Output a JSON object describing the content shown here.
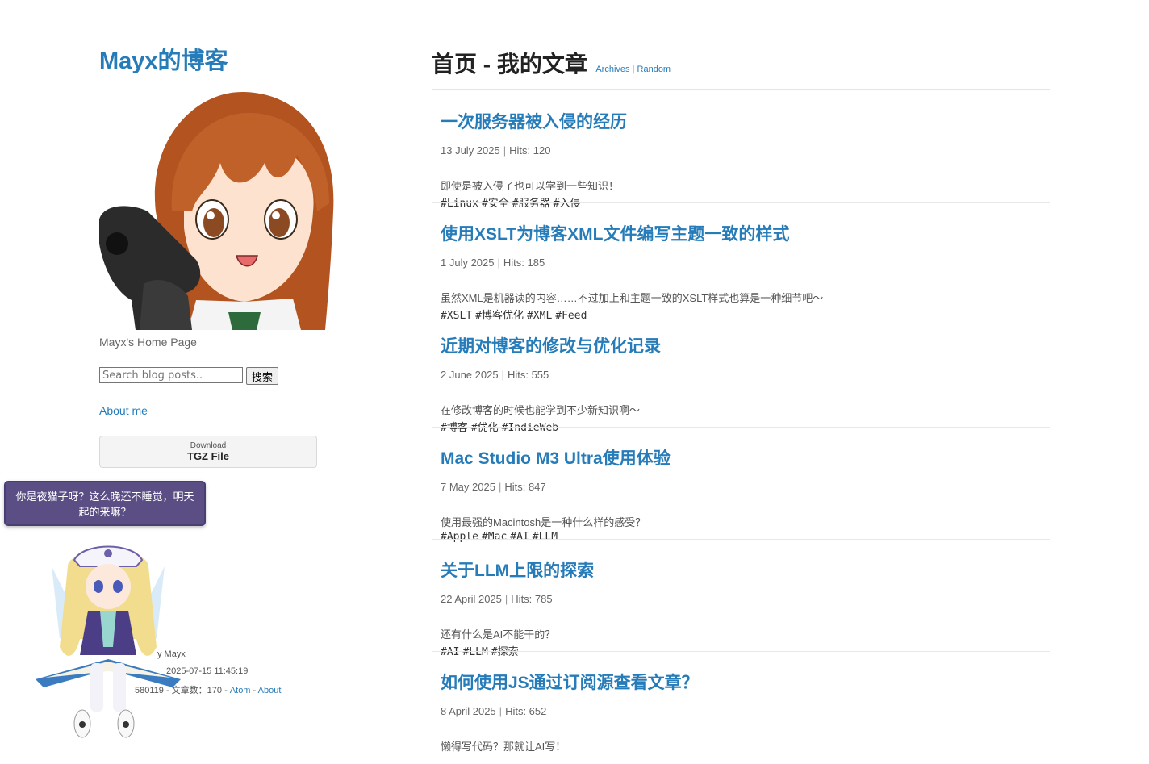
{
  "site": {
    "title": "Mayx的博客",
    "tagline": "Mayx's Home Page",
    "search": {
      "placeholder": "Search blog posts..",
      "button": "搜索"
    },
    "about_link": "About me",
    "download": {
      "small": "Download",
      "big": "TGZ File"
    },
    "footer": {
      "line1": "y Mayx",
      "line2": "2025-07-15 11:45:19",
      "line3_prefix": "580119 - 文章数：170 - ",
      "atom": "Atom",
      "dash": " - ",
      "about": "About"
    }
  },
  "bubble": {
    "text": "你是夜猫子呀？这么晚还不睡觉，明天起的来嘛？"
  },
  "header": {
    "title": "首页 - 我的文章",
    "archives": "Archives",
    "sep": "|",
    "random": "Random"
  },
  "posts": [
    {
      "title": "一次服务器被入侵的经历",
      "date": "13 July 2025",
      "hits": "Hits: 120",
      "excerpt": "即使是被入侵了也可以学到一些知识！",
      "tags": [
        "#Linux",
        "#安全",
        "#服务器",
        "#入侵"
      ]
    },
    {
      "title": "使用XSLT为博客XML文件编写主题一致的样式",
      "date": "1 July 2025",
      "hits": "Hits: 185",
      "excerpt": "虽然XML是机器读的内容……不过加上和主题一致的XSLT样式也算是一种细节吧～",
      "tags": [
        "#XSLT",
        "#博客优化",
        "#XML",
        "#Feed"
      ]
    },
    {
      "title": "近期对博客的修改与优化记录",
      "date": "2 June 2025",
      "hits": "Hits: 555",
      "excerpt": "在修改博客的时候也能学到不少新知识啊～",
      "tags": [
        "#博客",
        "#优化",
        "#IndieWeb"
      ]
    },
    {
      "title": "Mac Studio M3 Ultra使用体验",
      "date": "7 May 2025",
      "hits": "Hits: 847",
      "excerpt": "使用最强的Macintosh是一种什么样的感受？",
      "tags": [
        "#Apple",
        "#Mac",
        "#AI",
        "#LLM"
      ]
    },
    {
      "title": "关于LLM上限的探索",
      "date": "22 April 2025",
      "hits": "Hits: 785",
      "excerpt": "还有什么是AI不能干的？",
      "tags": [
        "#AI",
        "#LLM",
        "#探索"
      ]
    },
    {
      "title": "如何使用JS通过订阅源查看文章？",
      "date": "8 April 2025",
      "hits": "Hits: 652",
      "excerpt": "懒得写代码？那就让AI写！",
      "tags": []
    }
  ],
  "colors": {
    "link": "#267CB9",
    "bubble": "#5b4e85"
  }
}
